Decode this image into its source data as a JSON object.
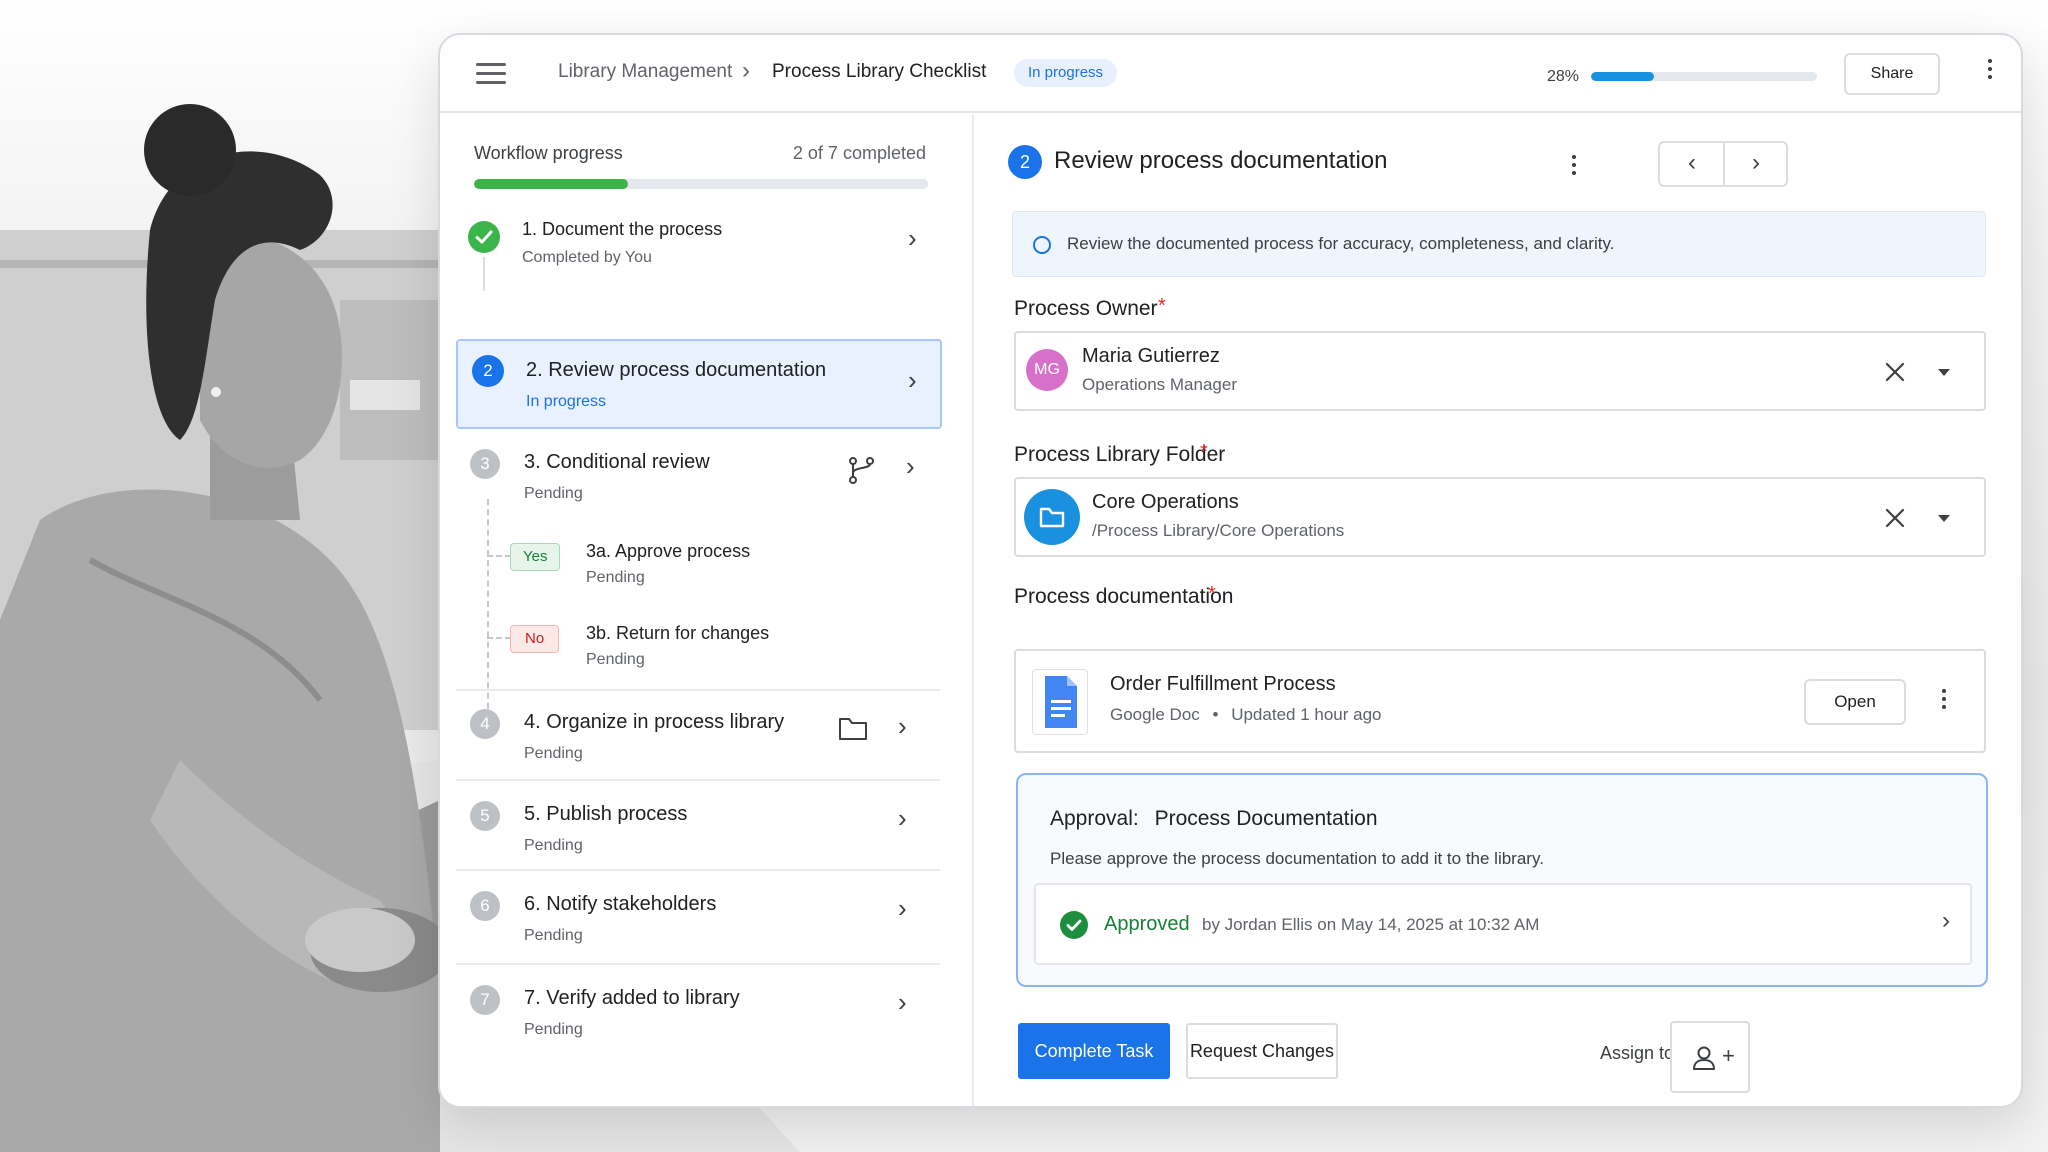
{
  "header": {
    "breadcrumb_parent": "Library Management",
    "breadcrumb_separator": "›",
    "breadcrumb_current": "Process Library Checklist",
    "status_badge": "In progress",
    "progress_label": "28%",
    "progress_fraction": 0.28,
    "share_label": "Share",
    "menu_icon": "hamburger-menu-icon",
    "more_icon": "more-vert-icon"
  },
  "workflow": {
    "label": "Workflow progress",
    "count": "2 of 7 completed",
    "progress_fraction": 0.34,
    "steps": [
      {
        "number": "",
        "title": "1. Document the process",
        "subtitle": "Completed by You",
        "state": "completed"
      },
      {
        "number": "2",
        "title": "2. Review process documentation",
        "subtitle": "In progress",
        "state": "active"
      },
      {
        "number": "3",
        "title": "3. Conditional review",
        "subtitle": "Pending",
        "state": "pending",
        "icon": "branch-icon"
      },
      {
        "number": "4",
        "title": "4. Organize in process library",
        "subtitle": "Pending",
        "state": "pending",
        "icon": "folder-icon"
      },
      {
        "number": "5",
        "title": "5. Publish process",
        "subtitle": "Pending",
        "state": "pending"
      },
      {
        "number": "6",
        "title": "6. Notify stakeholders",
        "subtitle": "Pending",
        "state": "pending"
      },
      {
        "number": "7",
        "title": "7. Verify added to library",
        "subtitle": "Pending",
        "state": "pending"
      }
    ],
    "branches": [
      {
        "condition": "Yes",
        "title": "3a. Approve process",
        "subtitle": "Pending"
      },
      {
        "condition": "No",
        "title": "3b. Return for changes",
        "subtitle": "Pending"
      }
    ]
  },
  "task": {
    "number": "2",
    "title": "Review process documentation",
    "instruction": "Review the documented process for accuracy, completeness, and clarity.",
    "required_marker": "*",
    "owner": {
      "label": "Process Owner",
      "initials": "MG",
      "name": "Maria Gutierrez",
      "role": "Operations Manager"
    },
    "folder": {
      "label": "Process Library Folder",
      "name": "Core Operations",
      "path": "/Process Library/Core Operations"
    },
    "documentation": {
      "label": "Process documentation",
      "name": "Order Fulfillment Process",
      "type": "Google Doc",
      "separator": "•",
      "updated": "Updated 1 hour ago",
      "open_label": "Open"
    },
    "approval": {
      "prefix": "Approval:",
      "title": "Process Documentation",
      "description": "Please approve the process documentation to add it to the library.",
      "status": "Approved",
      "by": "by Jordan Ellis on May 14, 2025 at 10:32 AM"
    },
    "actions": {
      "complete": "Complete Task",
      "request_changes": "Request Changes",
      "assign_label": "Assign to",
      "assign_plus": "+"
    }
  },
  "colors": {
    "accent": "#1a73e8",
    "success": "#1e8e3e",
    "progress": "#3bb54a",
    "required": "#d93025",
    "owner_avatar": "#d670c9"
  }
}
